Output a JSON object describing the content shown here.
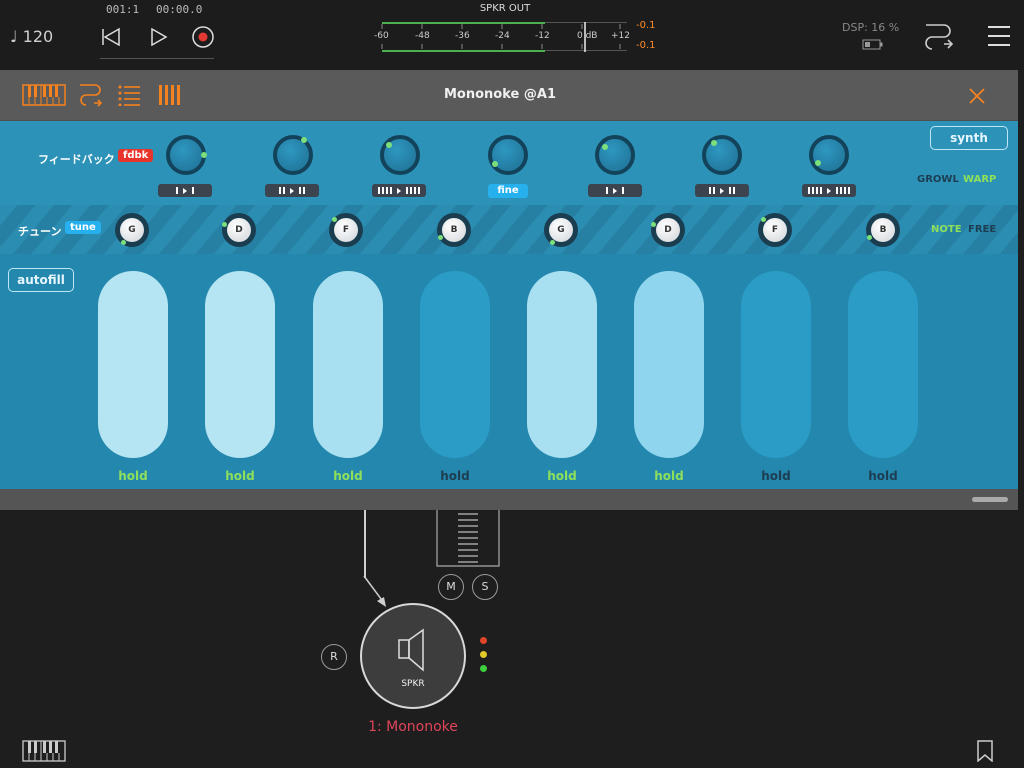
{
  "topbar": {
    "tempo": "♩ 120",
    "bar_position": "001:1",
    "time_position": "00:00.0",
    "rewind_icon": "skip-to-start-icon",
    "play_icon": "play-icon",
    "record_icon": "record-icon",
    "meter_title": "SPKR OUT",
    "meter_scale": [
      "-60",
      "-48",
      "-36",
      "-24",
      "-12",
      "0 dB",
      "+12"
    ],
    "peak_left": "-0.1",
    "peak_right": "-0.1",
    "dsp_label": "DSP: 16 %",
    "battery_icon": "battery-icon",
    "route_icon": "routing-icon",
    "menu_icon": "hamburger-menu-icon"
  },
  "plugin": {
    "title": "Mononoke @A1",
    "tabs": [
      "keyboard-icon",
      "routing-icon",
      "list-icon",
      "bars-icon"
    ],
    "close_icon": "close-icon",
    "row1": {
      "label": "フィードバック",
      "chip": "fdbk",
      "fine_label": "fine",
      "synth_button": "synth",
      "toggle_a": "GROWL",
      "toggle_b": "WARP"
    },
    "row2": {
      "label": "チューン",
      "chip": "tune",
      "notes": [
        "G",
        "D",
        "F",
        "B",
        "G",
        "D",
        "F",
        "B"
      ],
      "toggle_a": "NOTE",
      "toggle_b": "FREE"
    },
    "autofill": "autofill",
    "pads": [
      {
        "label": "hold",
        "active": true
      },
      {
        "label": "hold",
        "active": true
      },
      {
        "label": "hold",
        "active": true
      },
      {
        "label": "hold",
        "active": false
      },
      {
        "label": "hold",
        "active": true
      },
      {
        "label": "hold",
        "active": true
      },
      {
        "label": "hold",
        "active": false
      },
      {
        "label": "hold",
        "active": false
      }
    ]
  },
  "routing": {
    "mute_label": "M",
    "solo_label": "S",
    "record_label": "R",
    "node_label": "SPKR",
    "node_name": "1: Mononoke",
    "speaker_icon": "speaker-icon"
  },
  "colors": {
    "accent_orange": "#f5821f",
    "accent_green": "#8ee05a",
    "chip_red": "#e8342a",
    "chip_blue": "#27b0ee",
    "node_name": "#e0445a"
  }
}
